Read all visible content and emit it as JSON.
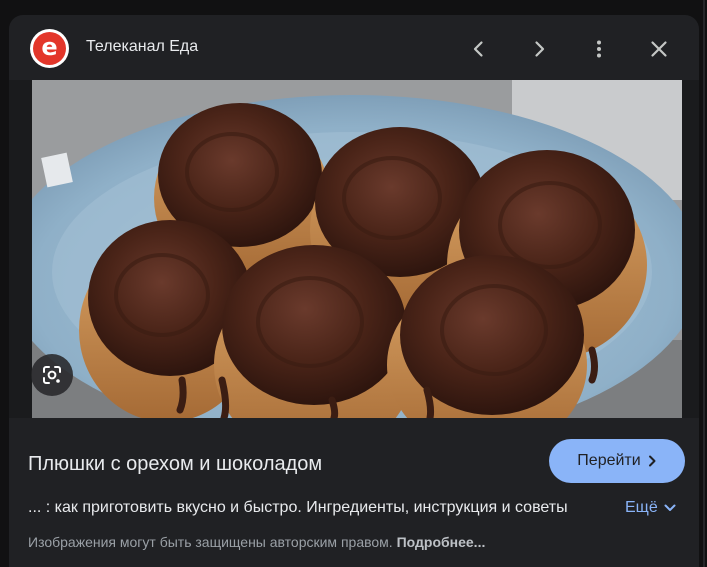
{
  "header": {
    "source_name": "Телеканал Еда",
    "logo_letter": "е",
    "prev_icon": "chevron-left-icon",
    "next_icon": "chevron-right-icon",
    "more_icon": "more-vert-icon",
    "close_icon": "close-icon"
  },
  "image": {
    "alt": "Плюшки с орехом и шоколадом",
    "lens_icon": "google-lens-icon"
  },
  "result": {
    "title": "Плюшки с орехом и шоколадом",
    "visit_label": "Перейти",
    "description": "... : как приготовить вкусно и быстро. Ингредиенты, инструкция и советы",
    "more_label": "Ещё",
    "copyright_text": "Изображения могут быть защищены авторским правом.",
    "learn_more": "Подробнее..."
  },
  "colors": {
    "panel_bg": "#202124",
    "accent": "#8ab4f8",
    "logo_red": "#e3362a",
    "text_primary": "#e8eaed",
    "text_secondary": "#9aa0a6"
  }
}
